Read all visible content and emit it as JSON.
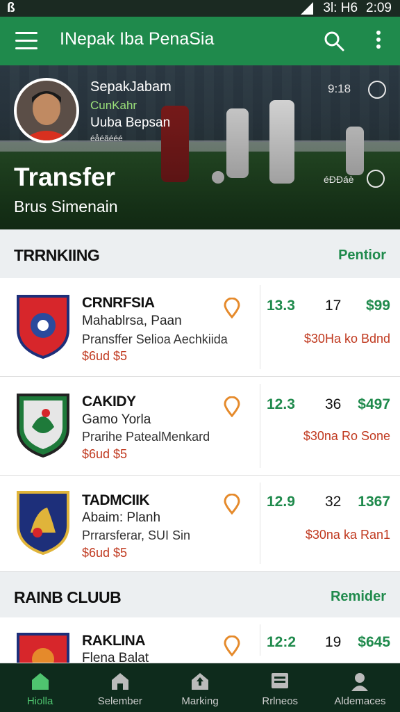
{
  "status": {
    "left": "ß",
    "right": "3l: H6",
    "time": "2:09"
  },
  "appbar": {
    "title": "INepak Iba PenaSia"
  },
  "hero": {
    "name": "SepakJabam",
    "role": "CunKahr",
    "club": "Uuba Bepsan",
    "small": "éåéãééé",
    "time1": "9:18",
    "headline": "Transfer",
    "subline": "Brus Simenain",
    "time2": "éÐÐáè"
  },
  "sections": [
    {
      "heading": "TRRNKIING",
      "action": "Pentior"
    },
    {
      "heading": "RAINB CLUUB",
      "action": "Remider"
    }
  ],
  "rows": [
    {
      "name": "CRNRFSIA",
      "sub": "Mahablrsa, Paan",
      "desc": "Pransffer Selioa Aechkiida",
      "price": "$6ud $5",
      "v1": "13.3",
      "v2": "17",
      "v3": "$99",
      "tag": "$30Ha ko Bdnd",
      "crest": "#d7262b",
      "crest_inner": "#2b4a9c"
    },
    {
      "name": "CAKIDY",
      "sub": "Gamo Yorla",
      "desc": "Prarihe PatealMenkard",
      "price": "$6ud $5",
      "v1": "12.3",
      "v2": "36",
      "v3": "$497",
      "tag": "$30na Ro Sone",
      "crest": "#1e7a3a",
      "crest_inner": "#e6e6e6"
    },
    {
      "name": "TADMCIIK",
      "sub": "Abaim: Planh",
      "desc": "Prrarsferar, SUI Sin",
      "price": "$6ud $5",
      "v1": "12.9",
      "v2": "32",
      "v3": "1367",
      "tag": "$30na ka Ran1",
      "crest": "#1d2f7a",
      "crest_inner": "#e0b43a"
    },
    {
      "name": "RAKLINA",
      "sub": "Flena Balat",
      "desc": "",
      "price": "",
      "v1": "12:2",
      "v2": "19",
      "v3": "$645",
      "tag": "",
      "crest": "#d7262b",
      "crest_inner": "#e58a2b"
    }
  ],
  "nav": [
    {
      "label": "Hiolla",
      "icon": "home-icon",
      "active": true
    },
    {
      "label": "Selember",
      "icon": "house-icon",
      "active": false
    },
    {
      "label": "Marking",
      "icon": "upload-icon",
      "active": false
    },
    {
      "label": "Rrlneos",
      "icon": "news-icon",
      "active": false
    },
    {
      "label": "Aldemaces",
      "icon": "profile-icon",
      "active": false
    }
  ],
  "colors": {
    "brand": "#1f8a4c",
    "accent": "#e58a2b",
    "price": "#c0391f",
    "nav_bg": "#0e2b1c"
  }
}
